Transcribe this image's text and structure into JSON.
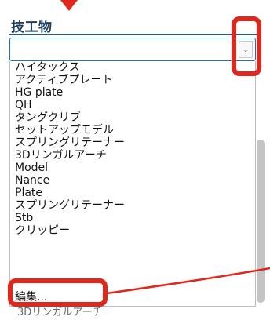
{
  "field": {
    "label": "技工物",
    "value": ""
  },
  "dropdown": {
    "options": [
      "ハイタックス",
      "アクティブプレート",
      "HG plate",
      "QH",
      "タングクリブ",
      "セットアップモデル",
      "スプリングリテーナー",
      "3Dリンガルアーチ",
      "Model",
      "Nance",
      "Plate",
      "スプリングリテーナー",
      "Stb",
      "クリッピー"
    ],
    "edit_label": "編集..."
  },
  "below": {
    "partial_text": "3Dリンガルアーチ"
  },
  "icons": {
    "select_arrow": "chevron-down-icon",
    "top_pointer": "arrow-down-icon"
  },
  "colors": {
    "annotation": "#e0271c",
    "label": "#1f3f5f",
    "focus_border": "#1f73b7"
  }
}
